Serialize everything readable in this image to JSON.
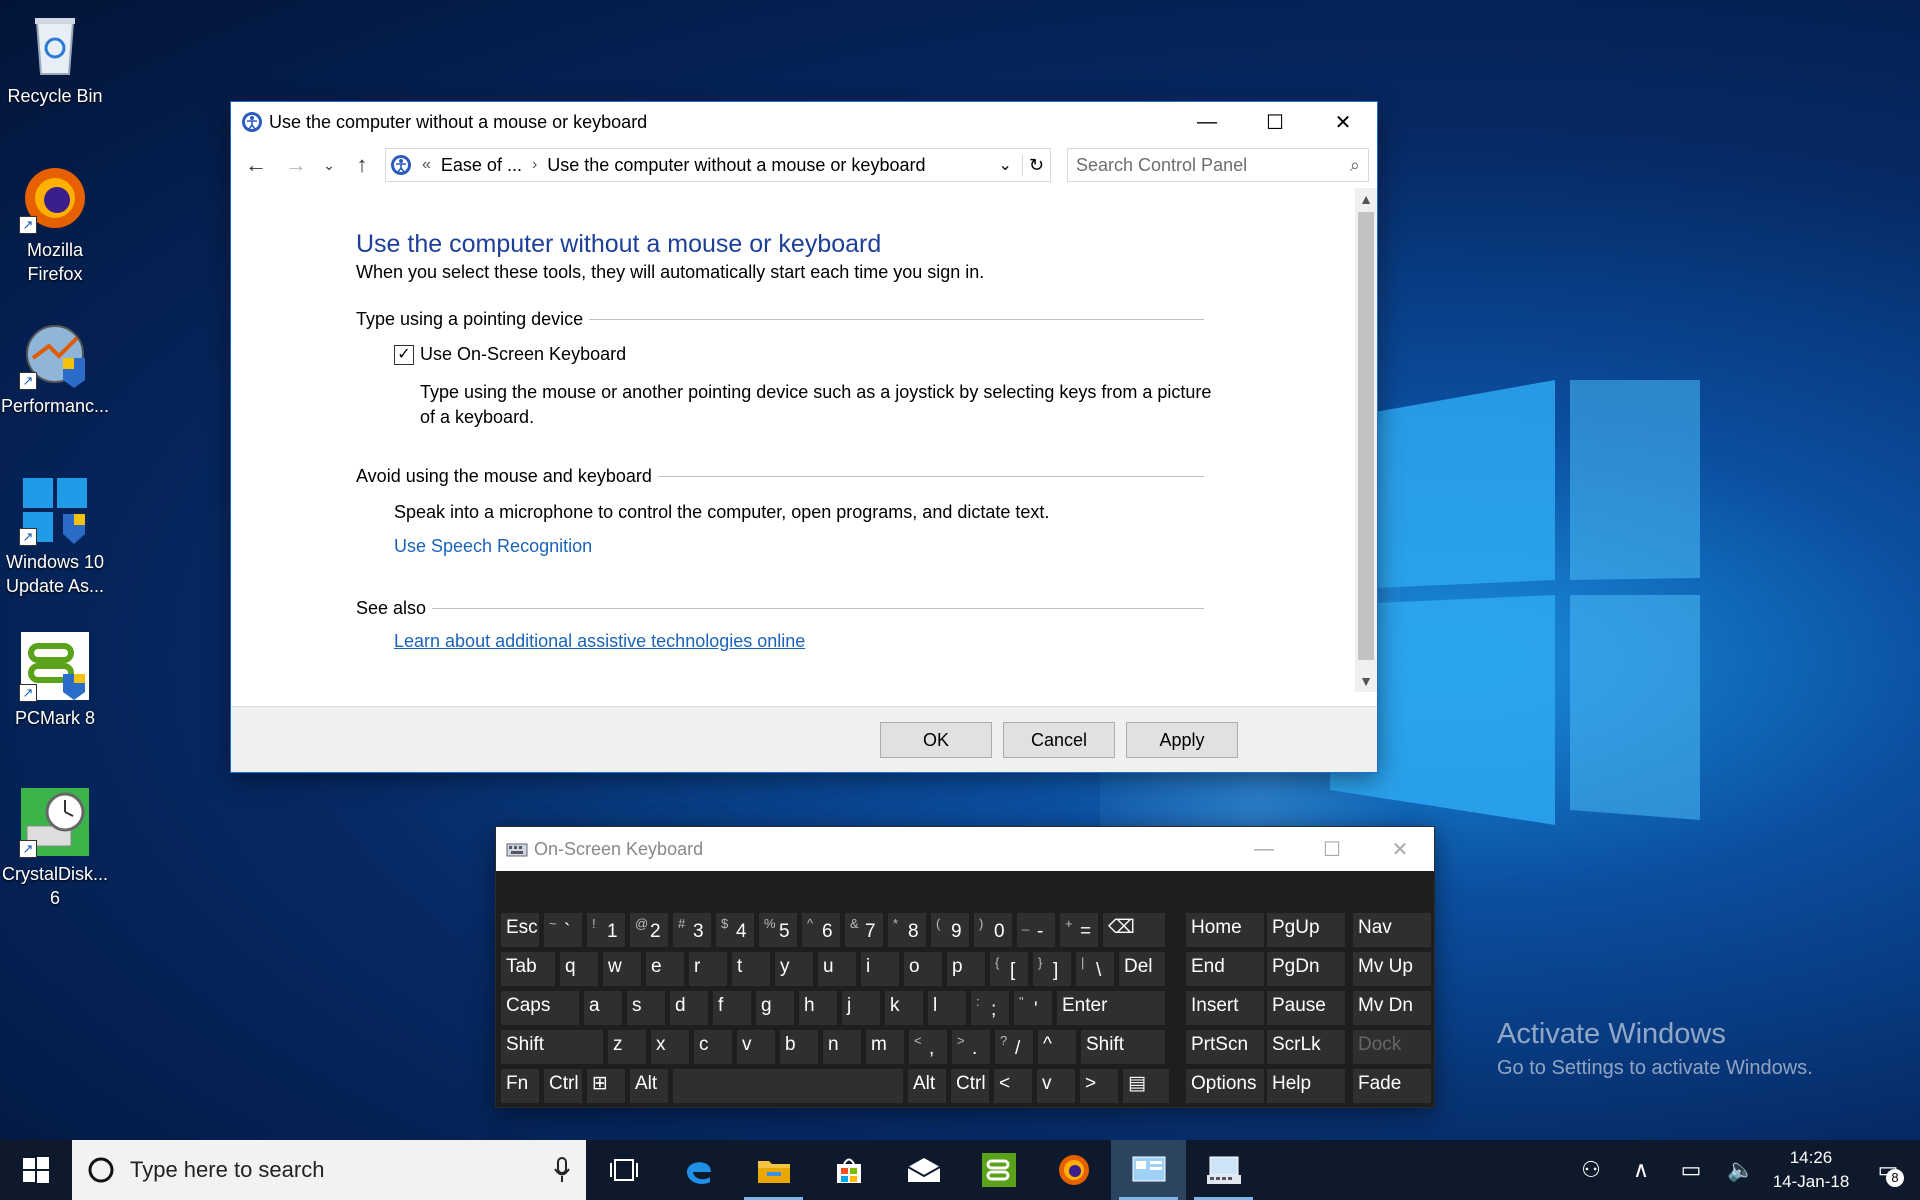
{
  "desktop": {
    "icons": [
      {
        "label": "Recycle Bin",
        "icon": "recycle-bin-icon"
      },
      {
        "label": "Mozilla Firefox",
        "icon": "firefox-icon"
      },
      {
        "label": "Performanc...",
        "icon": "performance-icon"
      },
      {
        "label": "Windows 10 Update As...",
        "icon": "windows-update-icon"
      },
      {
        "label": "PCMark 8",
        "icon": "pcmark-icon"
      },
      {
        "label": "CrystalDisk... 6",
        "icon": "crystaldisk-icon"
      }
    ],
    "watermark": {
      "line1": "Activate Windows",
      "line2": "Go to Settings to activate Windows."
    }
  },
  "control_panel": {
    "title": "Use the computer without a mouse or keyboard",
    "address": {
      "overflow": "«",
      "crumb1": "Ease of ...",
      "crumb2": "Use the computer without a mouse or keyboard"
    },
    "search_placeholder": "Search Control Panel",
    "heading": "Use the computer without a mouse or keyboard",
    "subheading": "When you select these tools, they will automatically start each time you sign in.",
    "section1": {
      "title": "Type using a pointing device",
      "checkbox_label": "Use On-Screen Keyboard",
      "checked": true,
      "description": "Type using the mouse or another pointing device such as a joystick by selecting keys from a picture of a keyboard."
    },
    "section2": {
      "title": "Avoid using the mouse and keyboard",
      "description": "Speak into a microphone to control the computer, open programs, and dictate text.",
      "link": "Use Speech Recognition"
    },
    "section3": {
      "title": "See also",
      "link": "Learn about additional assistive technologies online"
    },
    "buttons": {
      "ok": "OK",
      "cancel": "Cancel",
      "apply": "Apply"
    }
  },
  "osk": {
    "title": "On-Screen Keyboard",
    "rows": [
      [
        {
          "l": "Esc"
        },
        {
          "s": "~",
          "m": "`"
        },
        {
          "s": "!",
          "m": "1"
        },
        {
          "s": "@",
          "m": "2"
        },
        {
          "s": "#",
          "m": "3"
        },
        {
          "s": "$",
          "m": "4"
        },
        {
          "s": "%",
          "m": "5"
        },
        {
          "s": "^",
          "m": "6"
        },
        {
          "s": "&",
          "m": "7"
        },
        {
          "s": "*",
          "m": "8"
        },
        {
          "s": "(",
          "m": "9"
        },
        {
          "s": ")",
          "m": "0"
        },
        {
          "s": "_",
          "m": "-"
        },
        {
          "s": "+",
          "m": "="
        },
        {
          "l": "⌫"
        },
        {
          "l": "Home"
        },
        {
          "l": "PgUp"
        },
        {
          "l": "Nav"
        }
      ],
      [
        {
          "l": "Tab"
        },
        {
          "l": "q"
        },
        {
          "l": "w"
        },
        {
          "l": "e"
        },
        {
          "l": "r"
        },
        {
          "l": "t"
        },
        {
          "l": "y"
        },
        {
          "l": "u"
        },
        {
          "l": "i"
        },
        {
          "l": "o"
        },
        {
          "l": "p"
        },
        {
          "s": "{",
          "m": "["
        },
        {
          "s": "}",
          "m": "]"
        },
        {
          "s": "|",
          "m": "\\"
        },
        {
          "l": "Del"
        },
        {
          "l": "End"
        },
        {
          "l": "PgDn"
        },
        {
          "l": "Mv Up"
        }
      ],
      [
        {
          "l": "Caps"
        },
        {
          "l": "a"
        },
        {
          "l": "s"
        },
        {
          "l": "d"
        },
        {
          "l": "f"
        },
        {
          "l": "g"
        },
        {
          "l": "h"
        },
        {
          "l": "j"
        },
        {
          "l": "k"
        },
        {
          "l": "l"
        },
        {
          "s": ":",
          "m": ";"
        },
        {
          "s": "\"",
          "m": "'"
        },
        {
          "l": "Enter"
        },
        {
          "l": "Insert"
        },
        {
          "l": "Pause"
        },
        {
          "l": "Mv Dn"
        }
      ],
      [
        {
          "l": "Shift"
        },
        {
          "l": "z"
        },
        {
          "l": "x"
        },
        {
          "l": "c"
        },
        {
          "l": "v"
        },
        {
          "l": "b"
        },
        {
          "l": "n"
        },
        {
          "l": "m"
        },
        {
          "s": "<",
          "m": ","
        },
        {
          "s": ">",
          "m": "."
        },
        {
          "s": "?",
          "m": "/"
        },
        {
          "l": "^"
        },
        {
          "l": "Shift"
        },
        {
          "l": "PrtScn"
        },
        {
          "l": "ScrLk"
        },
        {
          "l": "Dock",
          "dim": true
        }
      ],
      [
        {
          "l": "Fn"
        },
        {
          "l": "Ctrl"
        },
        {
          "l": "⊞"
        },
        {
          "l": "Alt"
        },
        {
          "l": ""
        },
        {
          "l": "Alt"
        },
        {
          "l": "Ctrl"
        },
        {
          "l": "<"
        },
        {
          "l": "v"
        },
        {
          "l": ">"
        },
        {
          "l": "▤"
        },
        {
          "l": "Options"
        },
        {
          "l": "Help"
        },
        {
          "l": "Fade"
        }
      ]
    ]
  },
  "taskbar": {
    "search_placeholder": "Type here to search",
    "time": "14:26",
    "date": "14-Jan-18",
    "notification_count": "8"
  }
}
